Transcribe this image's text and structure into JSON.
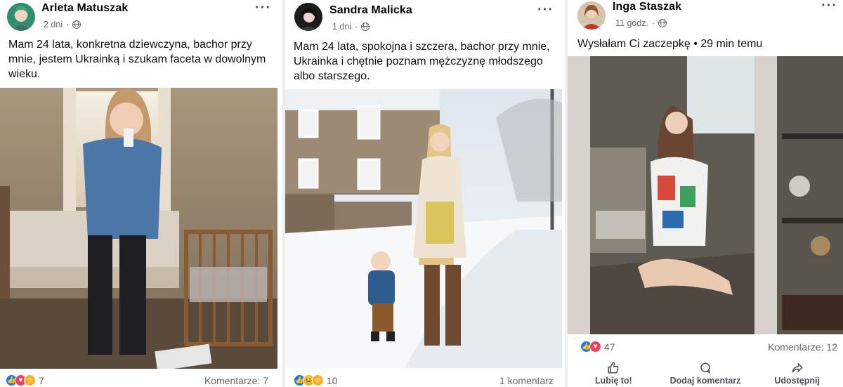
{
  "posts": [
    {
      "author": "Arleta Matuszak",
      "time": "2 dni",
      "text": "Mam 24 lata, konkretna dziewczyna, bachor przy mnie, jestem Ukrainką i szukam faceta w dowolnym wieku.",
      "reaction_icons": [
        "like-icon",
        "love-icon",
        "care-icon"
      ],
      "reaction_count": "7",
      "comments": "Komentarze: 7"
    },
    {
      "author": "Sandra Malicka",
      "time": "1 dni",
      "text": "Mam 24 lata, spokojna i szczera, bachor przy mnie, Ukrainka i chętnie poznam mężczyznę młodszego albo starszego.",
      "reaction_icons": [
        "like-icon",
        "haha-icon",
        "care-icon"
      ],
      "reaction_count": "10",
      "comments": "1 komentarz"
    },
    {
      "author": "Inga Staszak",
      "time": "11 godz.",
      "text": "Wysłałam Ci zaczepkę • 29 min temu",
      "reaction_icons": [
        "like-icon",
        "love-icon"
      ],
      "reaction_count": "47",
      "comments": "Komentarze: 12",
      "actions": {
        "like": "Lubię to!",
        "comment": "Dodaj komentarz",
        "share": "Udostępnij"
      }
    }
  ],
  "colors": {
    "like": "#1877f2",
    "love": "#f33e58",
    "haha": "#f7b125",
    "secondary_text": "#65676b"
  }
}
